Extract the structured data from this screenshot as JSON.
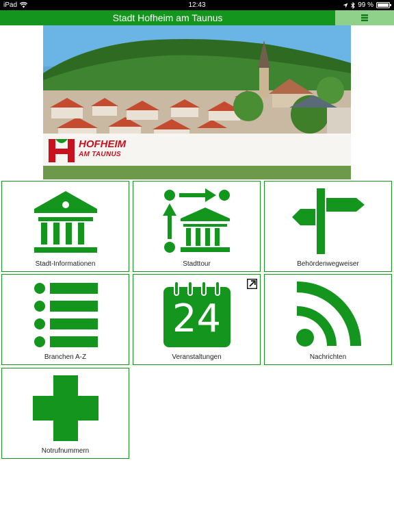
{
  "statusbar": {
    "device": "iPad",
    "time": "12:43",
    "battery": "99 %",
    "battery_level": 0.99
  },
  "header": {
    "title": "Stadt Hofheim am Taunus",
    "menu_icon": "hamburger-icon"
  },
  "banner": {
    "logo_main": "HOFHEIM",
    "logo_sub": "AM TAUNUS"
  },
  "tiles": [
    {
      "label": "Stadt-Informationen",
      "icon": "building-icon"
    },
    {
      "label": "Stadttour",
      "icon": "tour-route-icon"
    },
    {
      "label": "Behördenwegweiser",
      "icon": "signpost-icon"
    },
    {
      "label": "Branchen A-Z",
      "icon": "list-icon"
    },
    {
      "label": "Veranstaltungen",
      "icon": "calendar-icon",
      "calendar_day": "24",
      "badge": "external-link-icon"
    },
    {
      "label": "Nachrichten",
      "icon": "rss-icon"
    },
    {
      "label": "Notrufnummern",
      "icon": "medical-cross-icon"
    }
  ],
  "colors": {
    "brand_green": "#14961e",
    "menu_green": "#8fd08a",
    "logo_red": "#c8101e"
  }
}
